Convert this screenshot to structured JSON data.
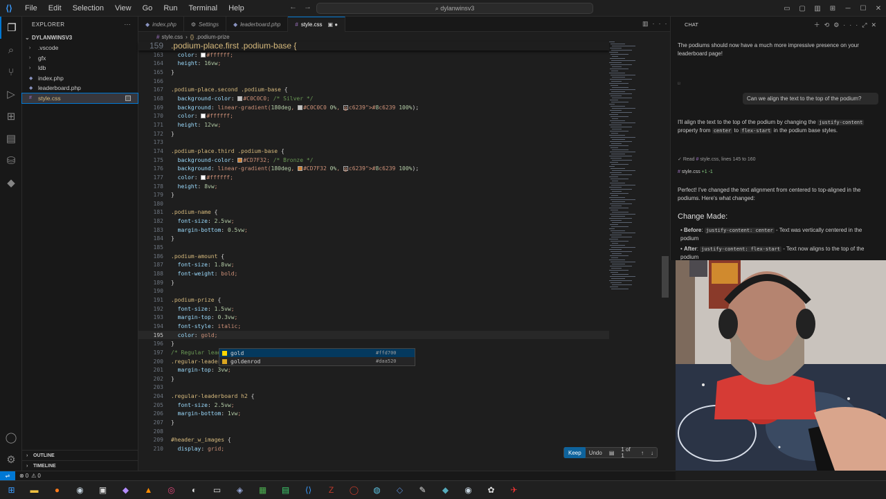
{
  "menu": [
    "File",
    "Edit",
    "Selection",
    "View",
    "Go",
    "Run",
    "Terminal",
    "Help"
  ],
  "search_label": "dylanwinsv3",
  "explorer": {
    "title": "EXPLORER",
    "root": "DYLANWINSV3",
    "items": [
      {
        "label": ".vscode",
        "kind": "folder"
      },
      {
        "label": "gfx",
        "kind": "folder"
      },
      {
        "label": "ldb",
        "kind": "folder"
      },
      {
        "label": "index.php",
        "kind": "php"
      },
      {
        "label": "leaderboard.php",
        "kind": "php"
      },
      {
        "label": "style.css",
        "kind": "css"
      }
    ],
    "outline": "OUTLINE",
    "timeline": "TIMELINE"
  },
  "tabs": [
    {
      "label": "index.php",
      "icon": "php"
    },
    {
      "label": "Settings",
      "icon": "gear"
    },
    {
      "label": "leaderboard.php",
      "icon": "php"
    },
    {
      "label": "style.css",
      "icon": "css",
      "active": true
    }
  ],
  "breadcrumb": {
    "file": "style.css",
    "symbol": ".podium-prize"
  },
  "sticky": {
    "num": "159",
    "text": ".podium-place.first .podium-base {"
  },
  "code": [
    {
      "n": "163",
      "t": "  color: ■#ffffff;"
    },
    {
      "n": "164",
      "t": "  height: 16vw;"
    },
    {
      "n": "165",
      "t": "}"
    },
    {
      "n": "166",
      "t": ""
    },
    {
      "n": "167",
      "t": ".podium-place.second .podium-base {"
    },
    {
      "n": "168",
      "t": "  background-color: ■#C0C0C0; /* Silver */"
    },
    {
      "n": "169",
      "t": "  background: linear-gradient(180deg, ■#C0C0C0 0%, ■#8c6239 100%);"
    },
    {
      "n": "170",
      "t": "  color: ■#ffffff;"
    },
    {
      "n": "171",
      "t": "  height: 12vw;"
    },
    {
      "n": "172",
      "t": "}"
    },
    {
      "n": "173",
      "t": ""
    },
    {
      "n": "174",
      "t": ".podium-place.third .podium-base {"
    },
    {
      "n": "175",
      "t": "  background-color: ■#CD7F32; /* Bronze */"
    },
    {
      "n": "176",
      "t": "  background: linear-gradient(180deg, ■#CD7F32 0%, ■#8c6239 100%);"
    },
    {
      "n": "177",
      "t": "  color: ■#ffffff;"
    },
    {
      "n": "178",
      "t": "  height: 8vw;"
    },
    {
      "n": "179",
      "t": "}"
    },
    {
      "n": "180",
      "t": ""
    },
    {
      "n": "181",
      "t": ".podium-name {"
    },
    {
      "n": "182",
      "t": "  font-size: 2.5vw;"
    },
    {
      "n": "183",
      "t": "  margin-bottom: 0.5vw;"
    },
    {
      "n": "184",
      "t": "}"
    },
    {
      "n": "185",
      "t": ""
    },
    {
      "n": "186",
      "t": ".podium-amount {"
    },
    {
      "n": "187",
      "t": "  font-size: 1.8vw;"
    },
    {
      "n": "188",
      "t": "  font-weight: bold;"
    },
    {
      "n": "189",
      "t": "}"
    },
    {
      "n": "190",
      "t": ""
    },
    {
      "n": "191",
      "t": ".podium-prize {"
    },
    {
      "n": "192",
      "t": "  font-size: 1.5vw;"
    },
    {
      "n": "193",
      "t": "  margin-top: 0.3vw;"
    },
    {
      "n": "194",
      "t": "  font-style: italic;"
    },
    {
      "n": "195",
      "t": "  color: gold;",
      "cur": true
    },
    {
      "n": "196",
      "t": "}"
    },
    {
      "n": "197",
      "t": "/* Regular leaderboard styles */"
    },
    {
      "n": "200",
      "t": ".regular-leaderboard {"
    },
    {
      "n": "201",
      "t": "  margin-top: 3vw;"
    },
    {
      "n": "202",
      "t": "}"
    },
    {
      "n": "203",
      "t": ""
    },
    {
      "n": "204",
      "t": ".regular-leaderboard h2 {"
    },
    {
      "n": "205",
      "t": "  font-size: 2.5vw;"
    },
    {
      "n": "206",
      "t": "  margin-bottom: 1vw;"
    },
    {
      "n": "207",
      "t": "}"
    },
    {
      "n": "208",
      "t": ""
    },
    {
      "n": "209",
      "t": "#header_w_images {"
    },
    {
      "n": "210",
      "t": "  display: grid;"
    }
  ],
  "suggest": [
    {
      "label": "gold",
      "hex": "#ffd700"
    },
    {
      "label": "goldenrod",
      "hex": "#daa520"
    }
  ],
  "keepbar": {
    "keep": "Keep",
    "undo": "Undo",
    "count": "1 of 1"
  },
  "chat": {
    "title": "CHAT",
    "msg1": "The podiums should now have a much more impressive presence on your leaderboard page!",
    "user": "Can we align the text to the top of the podium?",
    "reply_a": "I'll align the text to the top of the podium by changing the",
    "reply_code1": "justify-content",
    "reply_b": "property from",
    "reply_code2": "center",
    "reply_c": "to",
    "reply_code3": "flex-start",
    "reply_d": "in the podium base styles.",
    "read": "Read",
    "read_file": "style.css",
    "read_lines": ", lines 145 to 160",
    "edit_file": "style.css",
    "edit_stats": "+1 -1",
    "perfect": "Perfect! I've changed the text alignment from centered to top-aligned in the podiums. Here's what changed:",
    "heading": "Change Made:",
    "before_label": "Before",
    "before_code": "justify-content: center",
    "before_text": "- Text was vertically centered in the podium",
    "after_label": "After",
    "after_code": "justify-content: flex-start",
    "after_text": "- Text now aligns to the top of the podium"
  },
  "status": {
    "errors": "0",
    "warnings": "0"
  },
  "colors": {
    "accent": "#0078d4",
    "gold": "#ffd700",
    "silver": "#C0C0C0",
    "bronze": "#CD7F32",
    "brown": "#8c6239"
  }
}
